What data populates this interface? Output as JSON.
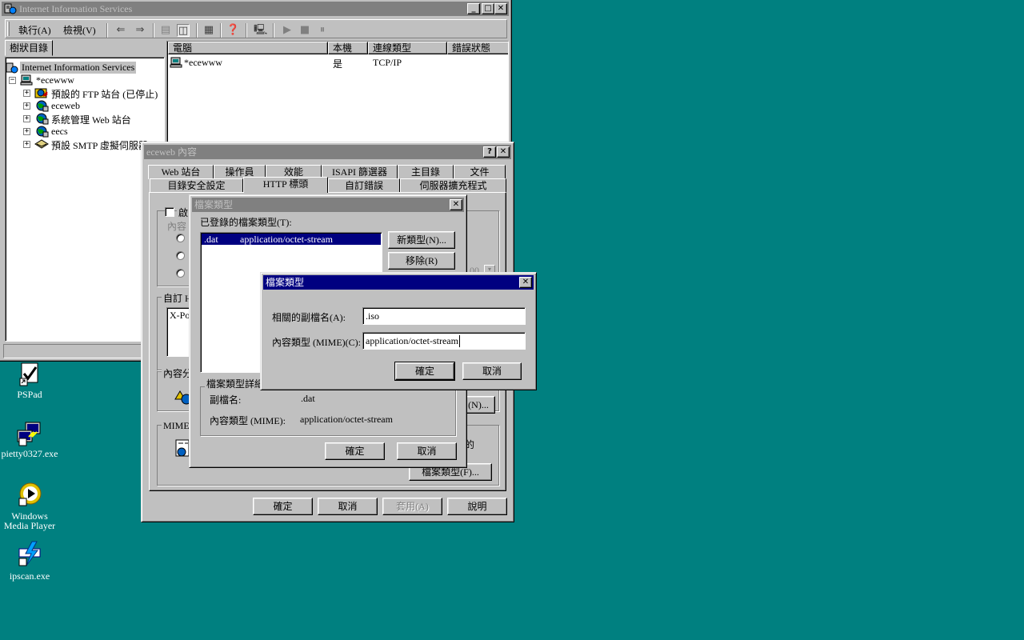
{
  "desktop": {
    "background": "#008080",
    "icons": [
      {
        "label": "PSPad",
        "icon": "pspad-icon"
      },
      {
        "label": "pietty0327.exe",
        "icon": "pietty-icon"
      },
      {
        "label": "Windows Media Player",
        "icon": "media-player-icon"
      },
      {
        "label": "ipscan.exe",
        "icon": "ipscan-icon"
      }
    ]
  },
  "iis": {
    "title": "Internet Information Services",
    "menu": {
      "action": "執行(A)",
      "view": "檢視(V)"
    },
    "tree_tab": "樹狀目錄",
    "tree_root": "Internet Information Services",
    "tree_server": "*ecewww",
    "tree_items": [
      "預設的 FTP 站台 (已停止)",
      "eceweb",
      "系統管理 Web 站台",
      "eecs",
      "預設 SMTP 虛擬伺服器"
    ],
    "list_headers": [
      "電腦",
      "本機",
      "連線類型",
      "錯誤狀態"
    ],
    "list_row": {
      "computer": "*ecewww",
      "local": "是",
      "conn": "TCP/IP",
      "error": ""
    }
  },
  "props": {
    "title": "eceweb 內容",
    "tabs_row1": [
      "Web 站台",
      "操作員",
      "效能",
      "ISAPI 篩選器",
      "主目錄",
      "文件"
    ],
    "tabs_row2": [
      "目錄安全設定",
      "HTTP 標頭",
      "自訂錯誤",
      "伺服器擴充程式"
    ],
    "enable_label": "啟",
    "content_label": "內容",
    "custom_http_label": "自訂 H",
    "custom_http_value": "X-Po",
    "content_rating_label": "內容分",
    "mime_label": "MIME",
    "right_partial": "的",
    "spinner_partial": "00",
    "edit_button": "(N)...",
    "file_types_button": "檔案類型(F)...",
    "ok": "確定",
    "cancel": "取消",
    "apply": "套用(A)",
    "help": "說明"
  },
  "filetypes": {
    "title": "檔案類型",
    "registered_label": "已登錄的檔案類型(T):",
    "items": [
      {
        "ext": ".dat",
        "mime": "application/octet-stream"
      }
    ],
    "new_type": "新類型(N)...",
    "remove": "移除(R)",
    "details_label": "檔案類型詳細",
    "ext_label": "副檔名:",
    "ext_value": ".dat",
    "mime_label": "內容類型 (MIME):",
    "mime_value": "application/octet-stream",
    "ok": "確定",
    "cancel": "取消"
  },
  "newtype": {
    "title": "檔案類型",
    "ext_label": "相關的副檔名(A):",
    "ext_value": ".iso",
    "mime_label": "內容類型 (MIME)(C):",
    "mime_value": "application/octet-stream",
    "ok": "確定",
    "cancel": "取消"
  }
}
